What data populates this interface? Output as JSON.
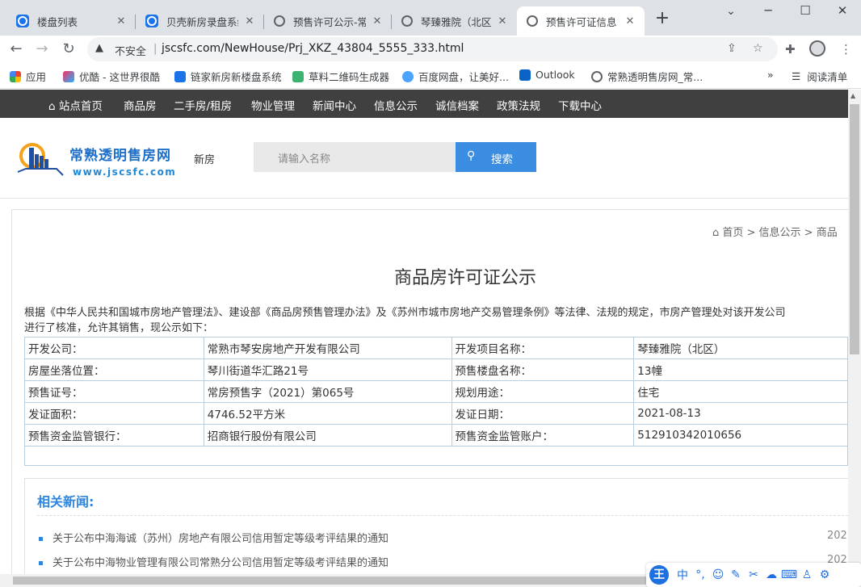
{
  "browser": {
    "tabs": [
      {
        "title": "楼盘列表",
        "favicon": "blue-app-icon"
      },
      {
        "title": "贝壳新房录盘系统",
        "favicon": "blue-app-icon"
      },
      {
        "title": "预售许可公示-常",
        "favicon": "globe-icon"
      },
      {
        "title": "琴臻雅院（北区）",
        "favicon": "globe-icon"
      },
      {
        "title": "预售许可证信息",
        "favicon": "globe-icon",
        "active": true
      }
    ],
    "new_tab": "+",
    "window_controls": {
      "minimize": "─",
      "restore": "☐",
      "close": "✕",
      "list": "⌄"
    },
    "security": "不安全",
    "url": "jscsfc.com/NewHouse/Prj_XKZ_43804_5555_333.html",
    "bookmarks": [
      {
        "label": "应用",
        "icon": "apps-grid-icon"
      },
      {
        "label": "优酷 - 这世界很酷",
        "icon": "youku-icon"
      },
      {
        "label": "链家新房新楼盘系统",
        "icon": "blue-app-icon"
      },
      {
        "label": "草料二维码生成器",
        "icon": "qr-icon"
      },
      {
        "label": "百度网盘，让美好...",
        "icon": "baidu-cloud-icon"
      },
      {
        "label": "Outlook",
        "icon": "outlook-icon"
      },
      {
        "label": "常熟透明售房网_常...",
        "icon": "globe-icon"
      }
    ],
    "reading_list": "阅读清单",
    "more_bookmarks": "»"
  },
  "site": {
    "nav": [
      "站点首页",
      "商品房",
      "二手房/租房",
      "物业管理",
      "新闻中心",
      "信息公示",
      "诚信档案",
      "政策法规",
      "下载中心"
    ],
    "logo_title": "常熟透明售房网",
    "logo_url": "www.jscsfc.com",
    "channel": "新房",
    "search_placeholder": "请输入名称",
    "search_button": "搜索",
    "breadcrumb": "首页 > 信息公示 > 商品",
    "title": "商品房许可证公示",
    "intro_line1": "根据《中华人民共和国城市房地产管理法》、建设部《商品房预售管理办法》及《苏州市城市房地产交易管理条例》等法律、法规的规定，市房产管理处对该开发公司",
    "intro_line2": "进行了核准，允许其销售，现公示如下：",
    "table": [
      [
        "开发公司：",
        "常熟市琴安房地产开发有限公司",
        "开发项目名称：",
        "琴臻雅院（北区）"
      ],
      [
        "房屋坐落位置：",
        "琴川街道华汇路21号",
        "预售楼盘名称：",
        "13幢"
      ],
      [
        "预售证号：",
        "常房预售字（2021）第065号",
        "规划用途：",
        "住宅"
      ],
      [
        "发证面积：",
        "4746.52平方米",
        "发证日期：",
        "2021-08-13"
      ],
      [
        "预售资金监管银行：",
        "招商银行股份有限公司",
        "预售资金监管账户：",
        "512910342010656"
      ]
    ],
    "news_heading": "相关新闻:",
    "news": [
      {
        "title": "关于公布中海海诚（苏州）房地产有限公司信用暂定等级考评结果的通知",
        "date": "202"
      },
      {
        "title": "关于公布中海物业管理有限公司常熟分公司信用暂定等级考评结果的通知",
        "date": "202"
      }
    ]
  },
  "ime": {
    "logo": "王",
    "mode": "中",
    "punct": "°,"
  },
  "colors": {
    "accent": "#3a8de0",
    "nav_bg": "#404040",
    "news_title": "#2e86de",
    "table_border": "#b9cfe0"
  }
}
